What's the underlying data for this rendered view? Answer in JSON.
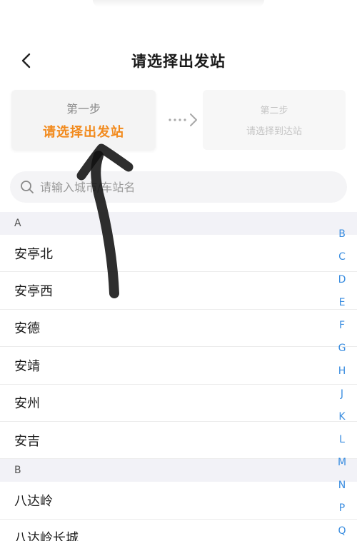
{
  "nav": {
    "title": "请选择出发站",
    "back_icon": "chevron-left-icon"
  },
  "steps": [
    {
      "step": "第一步",
      "text": "请选择出发站",
      "active": true
    },
    {
      "step": "第二步",
      "text": "请选择到达站",
      "active": false
    }
  ],
  "search": {
    "placeholder": "请输入城市/车站名",
    "value": ""
  },
  "sections": [
    {
      "letter": "A",
      "stations": [
        "安亭北",
        "安亭西",
        "安德",
        "安靖",
        "安州",
        "安吉"
      ]
    },
    {
      "letter": "B",
      "stations": [
        "八达岭",
        "八达岭长城"
      ]
    }
  ],
  "index_letters": [
    "B",
    "C",
    "D",
    "E",
    "F",
    "G",
    "H",
    "J",
    "K",
    "L",
    "M",
    "N",
    "P",
    "Q"
  ],
  "colors": {
    "accent": "#f28a1c",
    "index": "#3a8de0",
    "section_bg": "#f2f2f7"
  }
}
